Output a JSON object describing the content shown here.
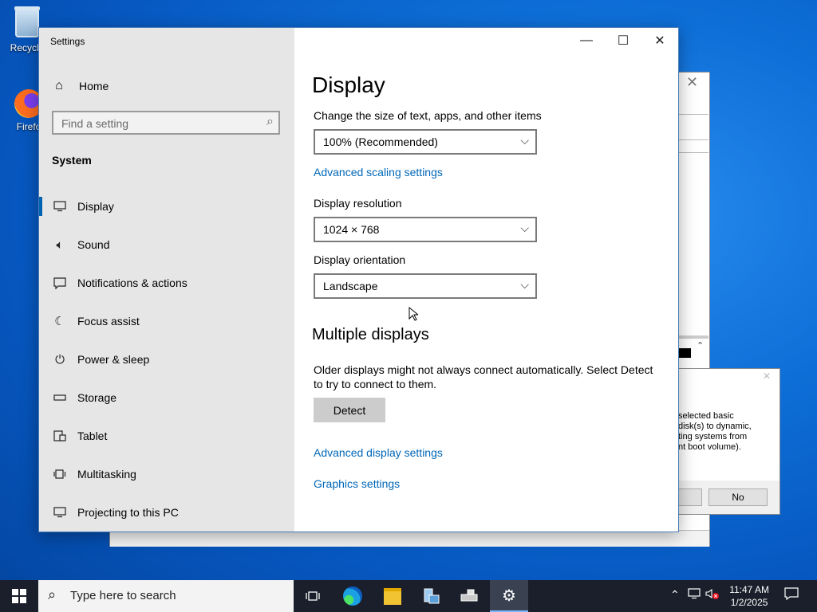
{
  "desktop": {
    "icons": [
      {
        "label": "Recycle",
        "icon": "recycle-bin-icon"
      },
      {
        "label": "Firefo",
        "icon": "firefox-icon"
      }
    ]
  },
  "background_dialog": {
    "text_lines": [
      "selected basic",
      "disk(s) to dynamic,",
      "ting systems from",
      "nt boot volume)."
    ],
    "no_label": "No"
  },
  "settings": {
    "title": "Settings",
    "home_label": "Home",
    "search_placeholder": "Find a setting",
    "section": "System",
    "nav": [
      {
        "label": "Display",
        "icon": "monitor-icon",
        "selected": true
      },
      {
        "label": "Sound",
        "icon": "speaker-icon"
      },
      {
        "label": "Notifications & actions",
        "icon": "notification-icon"
      },
      {
        "label": "Focus assist",
        "icon": "moon-icon"
      },
      {
        "label": "Power & sleep",
        "icon": "power-icon"
      },
      {
        "label": "Storage",
        "icon": "storage-icon"
      },
      {
        "label": "Tablet",
        "icon": "tablet-icon"
      },
      {
        "label": "Multitasking",
        "icon": "multitasking-icon"
      },
      {
        "label": "Projecting to this PC",
        "icon": "projecting-icon"
      }
    ],
    "page_title": "Display",
    "scale_label": "Change the size of text, apps, and other items",
    "scale_value": "100% (Recommended)",
    "advanced_scaling_link": "Advanced scaling settings",
    "resolution_label": "Display resolution",
    "resolution_value": "1024 × 768",
    "orientation_label": "Display orientation",
    "orientation_value": "Landscape",
    "multiple_heading": "Multiple displays",
    "multiple_text": "Older displays might not always connect automatically. Select Detect to try to connect to them.",
    "detect_label": "Detect",
    "advanced_display_link": "Advanced display settings",
    "graphics_link": "Graphics settings"
  },
  "taskbar": {
    "search_placeholder": "Type here to search",
    "time": "11:47 AM",
    "date": "1/2/2025"
  }
}
